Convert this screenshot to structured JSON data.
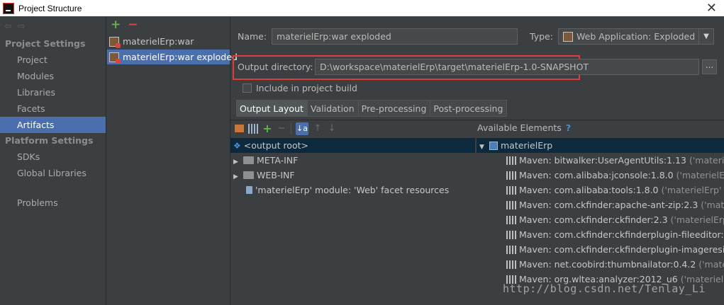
{
  "window": {
    "title": "Project Structure",
    "close_glyph": "✕"
  },
  "nav": {
    "back_glyph": "⇦",
    "forward_glyph": "⇨",
    "project_settings_heading": "Project Settings",
    "project_items": [
      "Project",
      "Modules",
      "Libraries",
      "Facets",
      "Artifacts"
    ],
    "selected": "Artifacts",
    "platform_settings_heading": "Platform Settings",
    "platform_items": [
      "SDKs",
      "Global Libraries"
    ],
    "problems": "Problems"
  },
  "artifacts": {
    "add_glyph": "+",
    "remove_glyph": "−",
    "items": [
      "materielErp:war",
      "materielErp:war exploded"
    ],
    "selected": "materielErp:war exploded"
  },
  "form": {
    "name_label": "Name:",
    "name_value": "materielErp:war exploded",
    "type_label": "Type:",
    "type_value": "Web Application: Exploded",
    "type_arrow": "▼",
    "output_dir_label": "Output directory:",
    "output_dir_value": "D:\\workspace\\materielErp\\target\\materielErp-1.0-SNAPSHOT",
    "browse_label": "...",
    "include_in_build_label": "Include in project build",
    "include_in_build_checked": false,
    "highlight_color": "#e23a3a"
  },
  "tabs": [
    "Output Layout",
    "Validation",
    "Pre-processing",
    "Post-processing"
  ],
  "active_tab": "Output Layout",
  "layout": {
    "toolbar_glyphs": {
      "sort": "↓a",
      "up": "↑",
      "down": "↓",
      "add": "+",
      "remove": "−"
    },
    "available_heading": "Available Elements",
    "help_glyph": "?",
    "output_tree": [
      {
        "label": "<output root>",
        "kind": "root",
        "expandable": false
      },
      {
        "label": "META-INF",
        "kind": "folder",
        "expandable": true
      },
      {
        "label": "WEB-INF",
        "kind": "folder",
        "expandable": true
      },
      {
        "label": "'materielErp' module: 'Web' facet resources",
        "kind": "facet",
        "expandable": false
      }
    ],
    "available_root": "materielErp",
    "available_items": [
      {
        "name": "Maven: bitwalker:UserAgentUtils:1.13",
        "suffix": "('materielEr"
      },
      {
        "name": "Maven: com.alibaba:jconsole:1.8.0",
        "suffix": "('materielErp' N"
      },
      {
        "name": "Maven: com.alibaba:tools:1.8.0",
        "suffix": "('materielErp' Mod"
      },
      {
        "name": "Maven: com.ckfinder:apache-ant-zip:2.3",
        "suffix": "('materie"
      },
      {
        "name": "Maven: com.ckfinder:ckfinder:2.3",
        "suffix": "('materielErp' M"
      },
      {
        "name": "Maven: com.ckfinder:ckfinderplugin-fileeditor:2.3",
        "suffix": "('"
      },
      {
        "name": "Maven: com.ckfinder:ckfinderplugin-imageresize:2",
        "suffix": ""
      },
      {
        "name": "Maven: net.coobird:thumbnailator:0.4.2",
        "suffix": "('materielE"
      },
      {
        "name": "Maven: org.wltea:analyzer:2012_u6",
        "suffix": "('materielErp'"
      }
    ]
  },
  "watermark": "http://blog.csdn.net/Tenlay_Li"
}
